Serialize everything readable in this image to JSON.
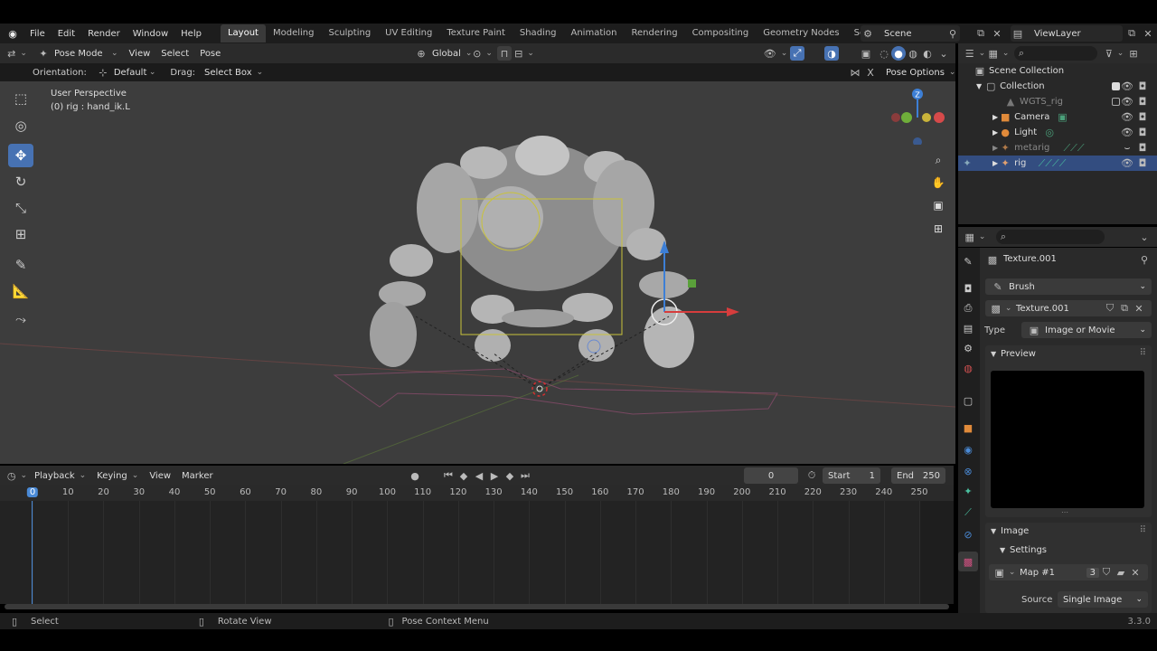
{
  "topbar": {
    "menus": [
      "File",
      "Edit",
      "Render",
      "Window",
      "Help"
    ],
    "workspaces": [
      "Layout",
      "Modeling",
      "Sculpting",
      "UV Editing",
      "Texture Paint",
      "Shading",
      "Animation",
      "Rendering",
      "Compositing",
      "Geometry Nodes",
      "Scripting"
    ],
    "add_tab": "+",
    "scene": "Scene",
    "view_layer": "ViewLayer"
  },
  "viewport_header": {
    "mode": "Pose Mode",
    "menus": [
      "View",
      "Select",
      "Pose"
    ],
    "transform": "Global"
  },
  "tool_settings": {
    "orientation_label": "Orientation:",
    "orientation_value": "Default",
    "drag_label": "Drag:",
    "drag_value": "Select Box",
    "pose_options": "Pose Options"
  },
  "viewport": {
    "perspective": "User Perspective",
    "object_info": "(0) rig : hand_ik.L",
    "gizmo_axis_label": "Z"
  },
  "timeline": {
    "menus": [
      "Playback",
      "Keying",
      "View",
      "Marker"
    ],
    "current_frame": "0",
    "start_label": "Start",
    "start": "1",
    "end_label": "End",
    "end": "250",
    "ticks": [
      "0",
      "10",
      "20",
      "30",
      "40",
      "50",
      "60",
      "70",
      "80",
      "90",
      "100",
      "110",
      "120",
      "130",
      "140",
      "150",
      "160",
      "170",
      "180",
      "190",
      "200",
      "210",
      "220",
      "230",
      "240",
      "250"
    ]
  },
  "outliner": {
    "root": "Scene Collection",
    "items": [
      {
        "name": "Collection",
        "level": 1,
        "dim": false
      },
      {
        "name": "WGTS_rig",
        "level": 2,
        "dim": true
      },
      {
        "name": "Camera",
        "level": 2,
        "dim": false
      },
      {
        "name": "Light",
        "level": 2,
        "dim": false
      },
      {
        "name": "metarig",
        "level": 2,
        "dim": true
      },
      {
        "name": "rig",
        "level": 2,
        "dim": false
      }
    ]
  },
  "properties": {
    "texture_name": "Texture.001",
    "brush": "Brush",
    "texture_field": "Texture.001",
    "type_label": "Type",
    "type_value": "Image or Movie",
    "preview_label": "Preview",
    "image_label": "Image",
    "settings_label": "Settings",
    "map_name": "Map #1",
    "map_users": "3",
    "source_label": "Source",
    "source_value": "Single Image"
  },
  "status": {
    "select": "Select",
    "rotate": "Rotate View",
    "context": "Pose Context Menu",
    "version": "3.3.0"
  },
  "colors": {
    "accent": "#4772b3",
    "selected_row": "#334d80",
    "viewport_bg": "#3d3d3d"
  }
}
